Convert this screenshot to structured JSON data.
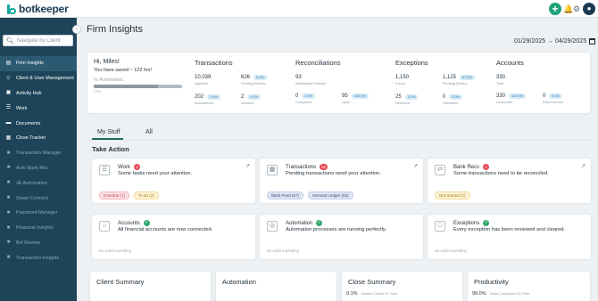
{
  "brand": {
    "name": "botkeeper",
    "accent": "#13a89e",
    "sidebar_bg": "#1d4458"
  },
  "topbar": {
    "add_icon": "plus-icon",
    "notif_icon": "bell-icon",
    "settings_icon": "gear-icon",
    "profile_icon": "user-icon"
  },
  "sidebar": {
    "search_placeholder": "Navigate by Client",
    "items": [
      {
        "label": "Firm Insights",
        "icon": "home-icon",
        "active": true
      },
      {
        "label": "Client & User Management",
        "icon": "users-icon"
      },
      {
        "label": "Activity Hub",
        "icon": "activity-icon"
      },
      {
        "label": "Work",
        "icon": "list-icon"
      },
      {
        "label": "Documents",
        "icon": "folder-icon"
      },
      {
        "label": "Close Tracker",
        "icon": "calendar-icon"
      },
      {
        "label": "Transaction Manager",
        "icon": "lock-icon",
        "dim": true
      },
      {
        "label": "Auto Bank Rec",
        "icon": "lock-icon",
        "dim": true
      },
      {
        "label": "JE Automation",
        "icon": "lock-icon",
        "dim": true
      },
      {
        "label": "Smart Connect",
        "icon": "lock-icon",
        "dim": true
      },
      {
        "label": "Password Manager",
        "icon": "lock-icon",
        "dim": true
      },
      {
        "label": "Financial Insights",
        "icon": "lock-icon",
        "dim": true
      },
      {
        "label": "BvI Review",
        "icon": "lock-icon",
        "dim": true
      },
      {
        "label": "Transaction Insights",
        "icon": "lock-icon",
        "dim": true
      }
    ]
  },
  "header": {
    "title": "Firm Insights",
    "date_from": "01/29/2025",
    "date_to": "04/29/2025"
  },
  "summary": {
    "greeting": "Hi, Miles!",
    "saved": "You have saved ~ 122 hrs!",
    "automated_label": "% Automated",
    "automated_value": "73%",
    "automated_fraction": 0.73,
    "transactions": {
      "title": "Transactions",
      "ingested": {
        "value": "10,039",
        "label": "Ingested"
      },
      "pending": {
        "value": "626",
        "pct": "6.2%",
        "label": "Pending Review"
      },
      "autonomous": {
        "value": "202",
        "pct": "2.0%",
        "label": "Autonomous"
      },
      "assisted": {
        "value": "2",
        "pct": "0.0%",
        "label": "Assisted"
      }
    },
    "reconciliations": {
      "title": "Reconciliations",
      "total": {
        "value": "93",
        "label": "Statements Fetched"
      },
      "completed": {
        "value": "0",
        "pct": "0.0%",
        "label": "Completed"
      },
      "open": {
        "value": "95",
        "pct": "100.0%",
        "label": "Open"
      }
    },
    "exceptions": {
      "title": "Exceptions",
      "found": {
        "value": "1,150",
        "label": "Found"
      },
      "pending": {
        "value": "1,125",
        "pct": "97.8%",
        "label": "Pending Review"
      },
      "resolved": {
        "value": "25",
        "pct": "2.2%",
        "label": "Resolved"
      },
      "dismissed": {
        "value": "0",
        "pct": "0.0%",
        "label": "Dismissed"
      }
    },
    "accounts": {
      "title": "Accounts",
      "total": {
        "value": "330",
        "label": "Total"
      },
      "connected": {
        "value": "330",
        "pct": "100.0%",
        "label": "Connected"
      },
      "disconnected": {
        "value": "0",
        "pct": "0.0%",
        "label": "Disconnected"
      }
    }
  },
  "tabs": {
    "my_stuff": "My Stuff",
    "all": "All"
  },
  "take_action": {
    "title": "Take Action",
    "work": {
      "title": "Work",
      "badge": "3",
      "text": "Some tasks need your attention.",
      "tags": [
        "Overdue (1)",
        "To do (2)"
      ]
    },
    "transactions": {
      "title": "Transactions",
      "badge": "63",
      "text": "Pending transactions need your attention.",
      "tags": [
        "Bank Feed (57)",
        "General Ledger (52)"
      ]
    },
    "bank_recs": {
      "title": "Bank Recs",
      "badge": "1",
      "text": "Some transactions need to be reconciled.",
      "tags": [
        "Not Started (1)"
      ]
    },
    "accounts": {
      "title": "Accounts",
      "text": "All financial accounts are now connected.",
      "no_actions": "No actions pending"
    },
    "automation": {
      "title": "Automation",
      "text": "Automation processes are running perfectly.",
      "no_actions": "No actions pending"
    },
    "exceptions": {
      "title": "Exceptions",
      "text": "Every exception has been reviewed and cleared.",
      "no_actions": "No actions pending"
    }
  },
  "bottom": {
    "client_summary": {
      "title": "Client Summary"
    },
    "automation": {
      "title": "Automation"
    },
    "close_summary": {
      "title": "Close Summary",
      "value": "0.1%",
      "label": "Months Closed On Time"
    },
    "productivity": {
      "title": "Productivity",
      "value": "99.0%",
      "label": "Tasks Completed On Time"
    }
  }
}
